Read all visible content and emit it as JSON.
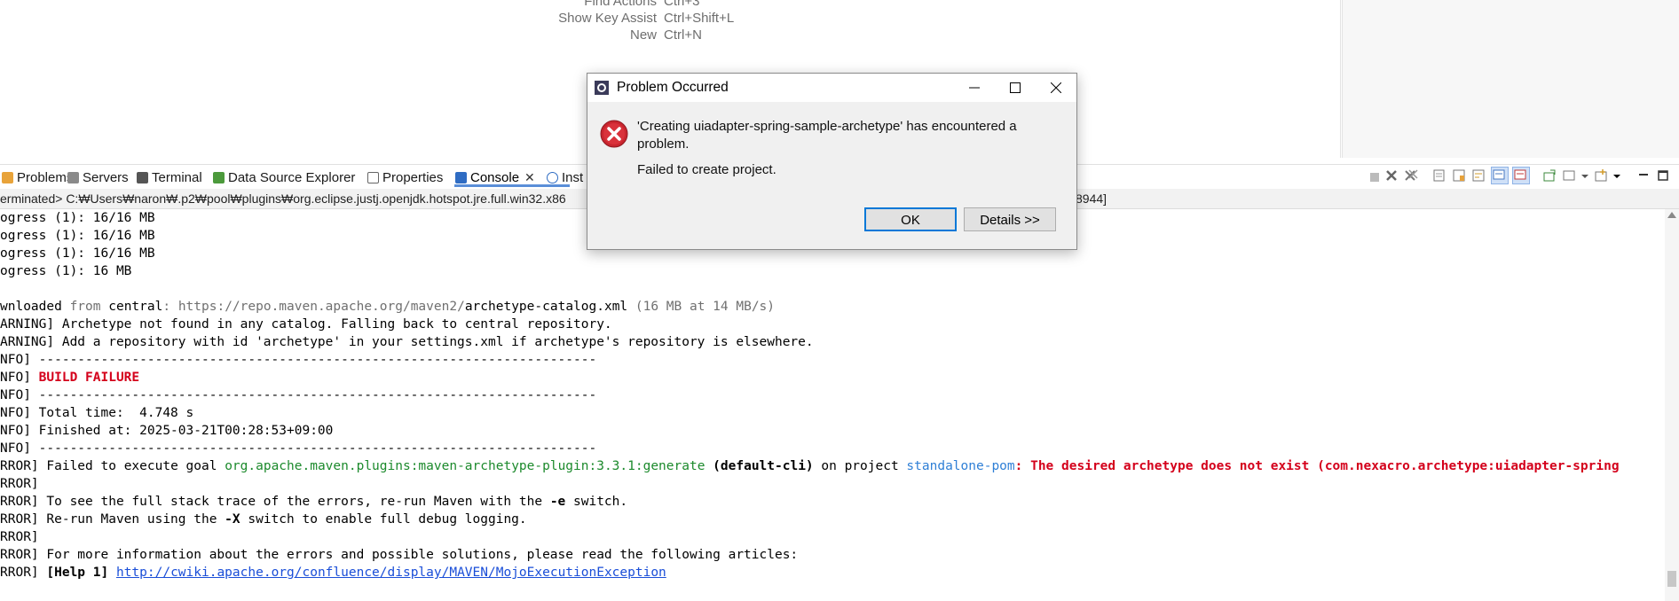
{
  "shortcut_hints": [
    {
      "label": "Find Actions",
      "key": "Ctrl+3"
    },
    {
      "label": "Show Key Assist",
      "key": "Ctrl+Shift+L"
    },
    {
      "label": "New",
      "key": "Ctrl+N"
    }
  ],
  "tabs": [
    {
      "label": "Problems",
      "icon": "problems-icon"
    },
    {
      "label": "Servers",
      "icon": "servers-icon"
    },
    {
      "label": "Terminal",
      "icon": "terminal-icon"
    },
    {
      "label": "Data Source Explorer",
      "icon": "data-source-icon"
    },
    {
      "label": "Properties",
      "icon": "properties-icon"
    },
    {
      "label": "Console",
      "icon": "console-icon",
      "active": true,
      "close": "✕"
    },
    {
      "label": "Inst",
      "icon": "info-icon"
    }
  ],
  "terminated": {
    "left": "erminated> C:₩Users₩naron₩.p2₩pool₩plugins₩org.eclipse.justj.openjdk.hotspot.jre.full.win32.x86",
    "right": "8944]"
  },
  "console": {
    "progress": [
      "ogress (1): 16/16 MB",
      "ogress (1): 16/16 MB",
      "ogress (1): 16/16 MB",
      "ogress (1): 16 MB"
    ],
    "download": {
      "pre": "wnloaded ",
      "from": "from ",
      "central": "central",
      "sep": ": ",
      "url": "https://repo.maven.apache.org/maven2/",
      "file": "archetype-catalog.xml",
      "rate": " (16 MB at 14 MB/s)"
    },
    "warn1": "ARNING] Archetype not found in any catalog. Falling back to central repository.",
    "warn2": "ARNING] Add a repository with id 'archetype' in your settings.xml if archetype's repository is elsewhere.",
    "sep": "NFO] ------------------------------------------------------------------------",
    "info_prefix": "NFO] ",
    "build_failure": "BUILD FAILURE",
    "total_time": "NFO] Total time:  4.748 s",
    "finished": "NFO] Finished at: 2025-03-21T00:28:53+09:00",
    "error_prefix": "RROR] ",
    "err_goal_pre": "Failed to execute goal ",
    "err_plugin": "org.apache.maven.plugins:maven-archetype-plugin:3.3.1:generate",
    "err_cli": " (default-cli)",
    "err_on": " on project ",
    "err_project": "standalone-pom",
    "err_msg": ": The desired archetype does not exist (com.nexacro.archetype:uiadapter-spring",
    "err_blank": "RROR]",
    "err_trace_pre": "RROR] To see the full stack trace of the errors, re-run Maven with the ",
    "err_trace_flag": "-e",
    "err_trace_post": " switch.",
    "err_debug_pre": "RROR] Re-run Maven using the ",
    "err_debug_flag": "-X",
    "err_debug_post": " switch to enable full debug logging.",
    "err_more": "RROR] For more information about the errors and possible solutions, please read the following articles:",
    "help_label": "[Help 1]",
    "help_url": "http://cwiki.apache.org/confluence/display/MAVEN/MojoExecutionException"
  },
  "dialog": {
    "title": "Problem Occurred",
    "message": "'Creating uiadapter-spring-sample-archetype' has encountered a problem.",
    "detail": "Failed to create project.",
    "ok_label": "OK",
    "details_label": "Details >>"
  },
  "colors": {
    "error_red": "#d4001b",
    "plugin_green": "#1c8a2c",
    "project_blue": "#2f7fd6",
    "link_blue": "#1a4ed8",
    "accent": "#0078d7"
  }
}
